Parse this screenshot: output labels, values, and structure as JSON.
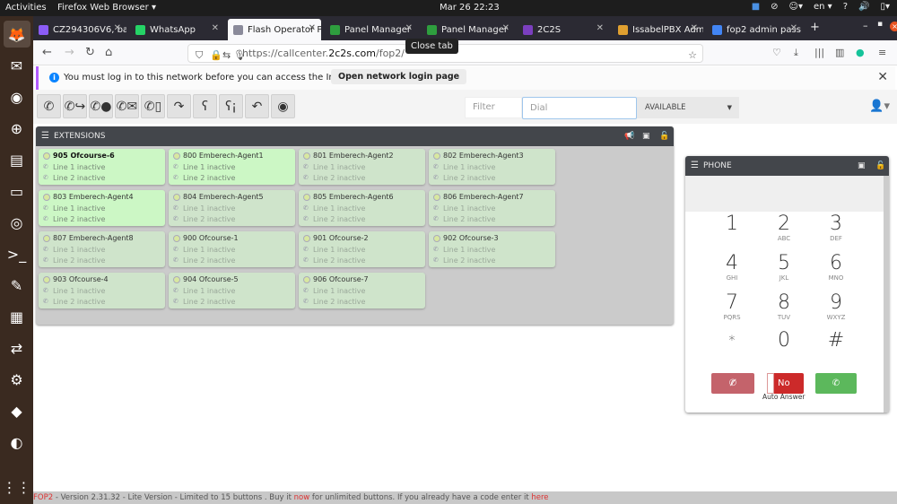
{
  "topbar": {
    "activities": "Activities",
    "app_menu": "Firefox Web Browser ▾",
    "clock": "Mar 26  22:23",
    "lang": "en ▾"
  },
  "dock": [
    {
      "name": "firefox-icon",
      "glyph": "🦊"
    },
    {
      "name": "thunderbird-icon",
      "glyph": "✉"
    },
    {
      "name": "rhythmbox-icon",
      "glyph": "◉"
    },
    {
      "name": "help-icon",
      "glyph": "⊕"
    },
    {
      "name": "libreoffice-writer-icon",
      "glyph": "▤"
    },
    {
      "name": "files-icon",
      "glyph": "▭"
    },
    {
      "name": "chrome-icon",
      "glyph": "◎"
    },
    {
      "name": "terminal-icon",
      "glyph": ">_"
    },
    {
      "name": "text-editor-icon",
      "glyph": "✎"
    },
    {
      "name": "archive-icon",
      "glyph": "▦"
    },
    {
      "name": "teamviewer-icon",
      "glyph": "⇄"
    },
    {
      "name": "settings-icon",
      "glyph": "⚙"
    },
    {
      "name": "anydesk-icon",
      "glyph": "◆"
    },
    {
      "name": "remmina-icon",
      "glyph": "◐"
    },
    {
      "name": "show-apps-icon",
      "glyph": "⋮⋮"
    }
  ],
  "tabs": [
    {
      "label": "CZ294306V6, ba",
      "color": "#8b5cf6"
    },
    {
      "label": "WhatsApp",
      "color": "#25d366"
    },
    {
      "label": "Flash Operator P",
      "color": "#8a8a9a",
      "selected": true
    },
    {
      "label": "Panel Manager",
      "color": "#2e9e3e"
    },
    {
      "label": "Panel Manager",
      "color": "#2e9e3e"
    },
    {
      "label": "2C2S",
      "color": "#7b3fbf"
    },
    {
      "label": "IssabelPBX Adm",
      "color": "#e0a030"
    },
    {
      "label": "fop2 admin pass",
      "color": "#4285f4"
    }
  ],
  "tooltip": "Close tab",
  "url": {
    "prefix": "https://callcenter.",
    "host": "2c2s.com",
    "path": "/fop2/"
  },
  "notification": {
    "message": "You must log in to this network before you can access the Internet.",
    "button": "Open network login page"
  },
  "toolbar": {
    "filter_placeholder": "Filter",
    "dial_placeholder": "Dial",
    "status": "AVAILABLE",
    "buttons": [
      "dial-icon",
      "transfer-icon",
      "voicemail-transfer-icon",
      "email-icon",
      "sms-icon",
      "hangup-icon",
      "listen-icon",
      "whisper-icon",
      "pickup-icon",
      "record-icon"
    ]
  },
  "extensions": {
    "title": "EXTENSIONS",
    "cards": [
      {
        "name": "905 Ofcourse-6",
        "line1": "Line 1 inactive",
        "line2": "Line 2 inactive",
        "online": true,
        "bold": true
      },
      {
        "name": "800 Emberech-Agent1",
        "line1": "Line 1 inactive",
        "line2": "Line 2 inactive",
        "online": true
      },
      {
        "name": "801 Emberech-Agent2",
        "line1": "Line 1 inactive",
        "line2": "Line 2 inactive",
        "online": false
      },
      {
        "name": "802 Emberech-Agent3",
        "line1": "Line 1 inactive",
        "line2": "Line 2 inactive",
        "online": false
      },
      {
        "name": "803 Emberech-Agent4",
        "line1": "Line 1 inactive",
        "line2": "Line 2 inactive",
        "online": true
      },
      {
        "name": "804 Emberech-Agent5",
        "line1": "Line 1 inactive",
        "line2": "Line 2 inactive",
        "online": false
      },
      {
        "name": "805 Emberech-Agent6",
        "line1": "Line 1 inactive",
        "line2": "Line 2 inactive",
        "online": false
      },
      {
        "name": "806 Emberech-Agent7",
        "line1": "Line 1 inactive",
        "line2": "Line 2 inactive",
        "online": false
      },
      {
        "name": "807 Emberech-Agent8",
        "line1": "Line 1 inactive",
        "line2": "Line 2 inactive",
        "online": false
      },
      {
        "name": "900 Ofcourse-1",
        "line1": "Line 1 inactive",
        "line2": "Line 2 inactive",
        "online": false
      },
      {
        "name": "901 Ofcourse-2",
        "line1": "Line 1 inactive",
        "line2": "Line 2 inactive",
        "online": false
      },
      {
        "name": "902 Ofcourse-3",
        "line1": "Line 1 inactive",
        "line2": "Line 2 inactive",
        "online": false
      },
      {
        "name": "903 Ofcourse-4",
        "line1": "Line 1 inactive",
        "line2": "Line 2 inactive",
        "online": false
      },
      {
        "name": "904 Ofcourse-5",
        "line1": "Line 1 inactive",
        "line2": "Line 2 inactive",
        "online": false
      },
      {
        "name": "906 Ofcourse-7",
        "line1": "Line 1 inactive",
        "line2": "Line 2 inactive",
        "online": false
      }
    ]
  },
  "phone": {
    "title": "PHONE",
    "keys": [
      {
        "d": "1",
        "s": ""
      },
      {
        "d": "2",
        "s": "ABC"
      },
      {
        "d": "3",
        "s": "DEF"
      },
      {
        "d": "4",
        "s": "GHI"
      },
      {
        "d": "5",
        "s": "JKL"
      },
      {
        "d": "6",
        "s": "MNO"
      },
      {
        "d": "7",
        "s": "PQRS"
      },
      {
        "d": "8",
        "s": "TUV"
      },
      {
        "d": "9",
        "s": "WXYZ"
      },
      {
        "d": "*",
        "s": ""
      },
      {
        "d": "0",
        "s": ""
      },
      {
        "d": "#",
        "s": ""
      }
    ],
    "auto_answer_value": "No",
    "auto_answer_label": "Auto Answer"
  },
  "footer": {
    "brand": "FOP2",
    "text1": " - Version 2.31.32 - Lite Version - Limited to 15 buttons . Buy it ",
    "link1": "now",
    "text2": " for unlimited buttons. If you already have a code enter it ",
    "link2": "here"
  }
}
